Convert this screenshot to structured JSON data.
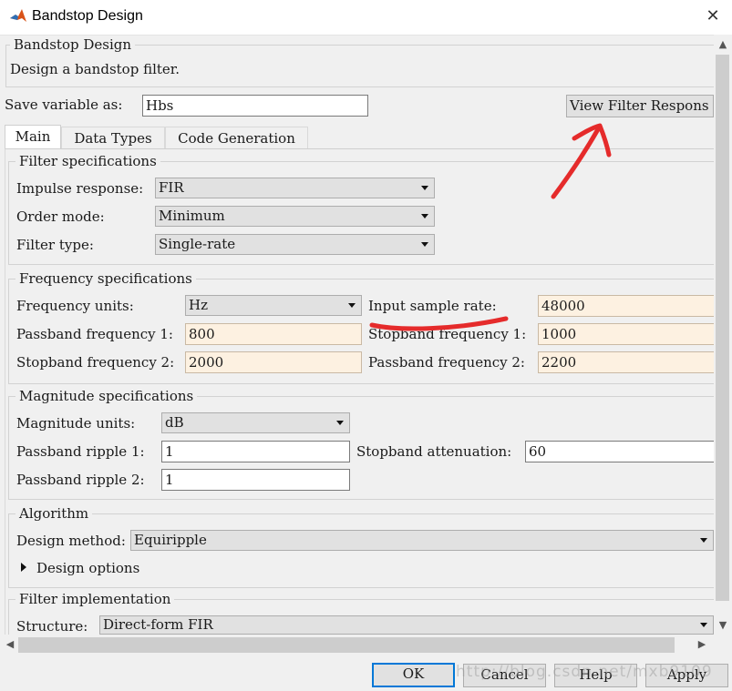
{
  "window": {
    "title": "Bandstop Design",
    "close_glyph": "✕"
  },
  "header": {
    "legend": "Bandstop Design",
    "description": "Design a bandstop filter."
  },
  "save": {
    "label": "Save variable as:",
    "value": "Hbs"
  },
  "view_button": "View Filter Respons",
  "tabs": [
    {
      "label": "Main",
      "active": true
    },
    {
      "label": "Data Types",
      "active": false
    },
    {
      "label": "Code Generation",
      "active": false
    }
  ],
  "filter_spec": {
    "legend": "Filter specifications",
    "impulse_label": "Impulse response:",
    "impulse_value": "FIR",
    "order_label": "Order mode:",
    "order_value": "Minimum",
    "type_label": "Filter type:",
    "type_value": "Single-rate"
  },
  "freq_spec": {
    "legend": "Frequency specifications",
    "units_label": "Frequency units:",
    "units_value": "Hz",
    "rate_label": "Input sample rate:",
    "rate_value": "48000",
    "pb1_label": "Passband frequency 1:",
    "pb1_value": "800",
    "sb1_label": "Stopband frequency 1:",
    "sb1_value": "1000",
    "sb2_label": "Stopband frequency 2:",
    "sb2_value": "2000",
    "pb2_label": "Passband frequency 2:",
    "pb2_value": "2200"
  },
  "mag_spec": {
    "legend": "Magnitude specifications",
    "units_label": "Magnitude units:",
    "units_value": "dB",
    "ripple1_label": "Passband ripple 1:",
    "ripple1_value": "1",
    "atten_label": "Stopband attenuation:",
    "atten_value": "60",
    "ripple2_label": "Passband ripple 2:",
    "ripple2_value": "1"
  },
  "algorithm": {
    "legend": "Algorithm",
    "method_label": "Design method:",
    "method_value": "Equiripple",
    "options_label": "Design options"
  },
  "implementation": {
    "legend": "Filter implementation",
    "structure_label": "Structure:",
    "structure_value": "Direct-form FIR"
  },
  "buttons": {
    "ok": "OK",
    "cancel": "Cancel",
    "help": "Help",
    "apply": "Apply"
  },
  "watermark": "http://blog.csdn.net/mxb9109",
  "colors": {
    "annotation": "#e52b2b",
    "highlight_field": "#fdf1e1",
    "default_button_border": "#0078d7"
  }
}
